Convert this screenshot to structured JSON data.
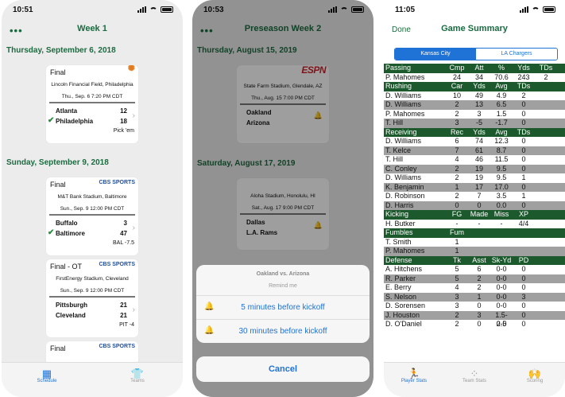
{
  "phone1": {
    "time": "10:51",
    "nav_title": "Week 1",
    "sections": [
      {
        "label": "Thursday, September 6, 2018"
      },
      {
        "label": "Sunday, September 9, 2018"
      }
    ],
    "games": [
      {
        "status": "Final",
        "network": "NBC",
        "venue": "Lincoln Financial Field, Philadelphia",
        "when": "Thu., Sep. 6 7:20 PM CDT",
        "away": "Atlanta",
        "away_score": "12",
        "home": "Philadelphia",
        "home_score": "18",
        "note": "Pick 'em"
      },
      {
        "status": "Final",
        "network": "CBS SPORTS",
        "venue": "M&T Bank Stadium, Baltimore",
        "when": "Sun., Sep. 9 12:00 PM CDT",
        "away": "Buffalo",
        "away_score": "3",
        "home": "Baltimore",
        "home_score": "47",
        "note": "BAL -7.5"
      },
      {
        "status": "Final - OT",
        "network": "CBS SPORTS",
        "venue": "FirstEnergy Stadium, Cleveland",
        "when": "Sun., Sep. 9 12:00 PM CDT",
        "away": "Pittsburgh",
        "away_score": "21",
        "home": "Cleveland",
        "home_score": "21",
        "note": "PIT -4"
      },
      {
        "status": "Final",
        "network": "CBS SPORTS"
      }
    ],
    "tabs": [
      {
        "label": "Schedule"
      },
      {
        "label": "Teams"
      }
    ]
  },
  "phone2": {
    "time": "10:53",
    "nav_title": "Preseason Week 2",
    "sections": [
      {
        "label": "Thursday, August 15, 2019"
      },
      {
        "label": "Saturday, August 17, 2019"
      }
    ],
    "games": [
      {
        "network": "ESPN",
        "venue": "State Farm Stadium, Glendale, AZ",
        "when": "Thu., Aug. 15 7:00 PM CDT",
        "away": "Oakland",
        "home": "Arizona"
      },
      {
        "venue": "Aloha Stadium, Honolulu, HI",
        "when": "Sat., Aug. 17 9:00 PM CDT",
        "away": "Dallas",
        "home": "L.A. Rams"
      }
    ],
    "sheet": {
      "title": "Oakland vs. Arizona",
      "subtitle": "Remind me",
      "options": [
        "5 minutes before kickoff",
        "30 minutes before kickoff"
      ],
      "cancel": "Cancel"
    }
  },
  "phone3": {
    "time": "11:05",
    "done": "Done",
    "nav_title": "Game Summary",
    "segments": [
      "Kansas City",
      "LA Chargers"
    ],
    "tabs": [
      {
        "label": "Player Stats"
      },
      {
        "label": "Team Stats"
      },
      {
        "label": "Scoring"
      }
    ],
    "stat_rows": [
      {
        "t": "hdr",
        "c": [
          "Passing",
          "Cmp",
          "Att",
          "%",
          "Yds",
          "TDs"
        ]
      },
      {
        "t": "odd",
        "c": [
          "P. Mahomes",
          "24",
          "34",
          "70.6",
          "243",
          "2"
        ]
      },
      {
        "t": "hdr",
        "c": [
          "Rushing",
          "Car",
          "Yds",
          "Avg",
          "TDs",
          ""
        ]
      },
      {
        "t": "odd",
        "c": [
          "D. Williams",
          "10",
          "49",
          "4.9",
          "2",
          ""
        ]
      },
      {
        "t": "even",
        "c": [
          "D. Williams",
          "2",
          "13",
          "6.5",
          "0",
          ""
        ]
      },
      {
        "t": "odd",
        "c": [
          "P. Mahomes",
          "2",
          "3",
          "1.5",
          "0",
          ""
        ]
      },
      {
        "t": "even",
        "c": [
          "T. Hill",
          "3",
          "-5",
          "-1.7",
          "0",
          ""
        ]
      },
      {
        "t": "hdr",
        "c": [
          "Receiving",
          "Rec",
          "Yds",
          "Avg",
          "TDs",
          ""
        ]
      },
      {
        "t": "odd",
        "c": [
          "D. Williams",
          "6",
          "74",
          "12.3",
          "0",
          ""
        ]
      },
      {
        "t": "even",
        "c": [
          "T. Kelce",
          "7",
          "61",
          "8.7",
          "0",
          ""
        ]
      },
      {
        "t": "odd",
        "c": [
          "T. Hill",
          "4",
          "46",
          "11.5",
          "0",
          ""
        ]
      },
      {
        "t": "even",
        "c": [
          "C. Conley",
          "2",
          "19",
          "9.5",
          "0",
          ""
        ]
      },
      {
        "t": "odd",
        "c": [
          "D. Williams",
          "2",
          "19",
          "9.5",
          "1",
          ""
        ]
      },
      {
        "t": "even",
        "c": [
          "K. Benjamin",
          "1",
          "17",
          "17.0",
          "0",
          ""
        ]
      },
      {
        "t": "odd",
        "c": [
          "D. Robinson",
          "2",
          "7",
          "3.5",
          "1",
          ""
        ]
      },
      {
        "t": "even",
        "c": [
          "D. Harris",
          "0",
          "0",
          "0.0",
          "0",
          ""
        ]
      },
      {
        "t": "hdr",
        "c": [
          "Kicking",
          "FG",
          "Made",
          "Miss",
          "XP",
          ""
        ]
      },
      {
        "t": "odd",
        "c": [
          "H. Butker",
          "-",
          "-",
          "-",
          "4/4",
          ""
        ]
      },
      {
        "t": "hdr",
        "c": [
          "Fumbles",
          "Fum",
          "",
          "",
          "",
          ""
        ]
      },
      {
        "t": "odd",
        "c": [
          "T. Smith",
          "1",
          "",
          "",
          "",
          ""
        ]
      },
      {
        "t": "even",
        "c": [
          "P. Mahomes",
          "1",
          "",
          "",
          "",
          ""
        ]
      },
      {
        "t": "hdr",
        "c": [
          "Defense",
          "Tk",
          "Asst",
          "Sk-Yd",
          "PD",
          ""
        ]
      },
      {
        "t": "odd",
        "c": [
          "A. Hitchens",
          "5",
          "6",
          "0-0",
          "0",
          ""
        ]
      },
      {
        "t": "even",
        "c": [
          "R. Parker",
          "5",
          "2",
          "0-0",
          "0",
          ""
        ]
      },
      {
        "t": "odd",
        "c": [
          "E. Berry",
          "4",
          "2",
          "0-0",
          "0",
          ""
        ]
      },
      {
        "t": "even",
        "c": [
          "S. Nelson",
          "3",
          "1",
          "0-0",
          "3",
          ""
        ]
      },
      {
        "t": "odd",
        "c": [
          "D. Sorensen",
          "3",
          "0",
          "0-0",
          "0",
          ""
        ]
      },
      {
        "t": "even",
        "c": [
          "J. Houston",
          "2",
          "3",
          "1.5-2.5",
          "0",
          ""
        ]
      },
      {
        "t": "odd",
        "c": [
          "D. O'Daniel",
          "2",
          "0",
          "0-0",
          "0",
          ""
        ]
      }
    ]
  },
  "colors": {
    "accent_green": "#1a6b3f",
    "ios_blue": "#1f73d6",
    "header_green": "#1c5a2d"
  }
}
